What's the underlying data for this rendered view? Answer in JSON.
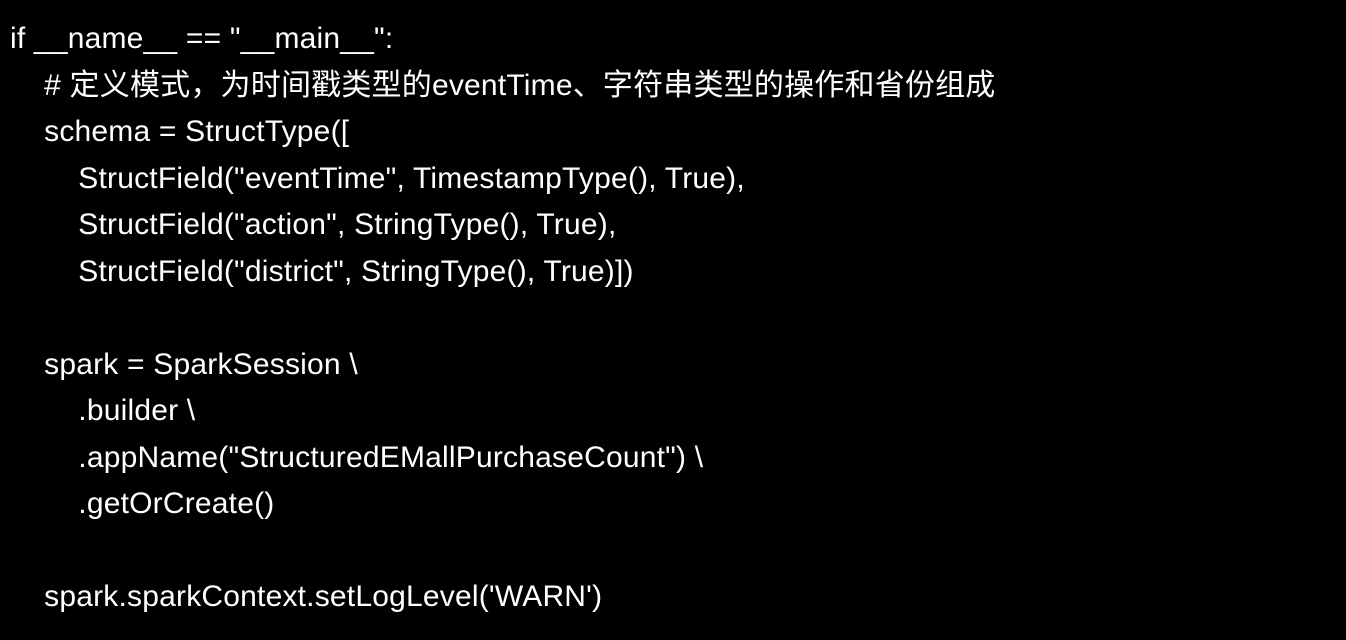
{
  "code": {
    "lines": [
      "if __name__ == \"__main__\":",
      "    # 定义模式，为时间戳类型的eventTime、字符串类型的操作和省份组成",
      "    schema = StructType([",
      "        StructField(\"eventTime\", TimestampType(), True),",
      "        StructField(\"action\", StringType(), True),",
      "        StructField(\"district\", StringType(), True)])",
      "",
      "    spark = SparkSession \\",
      "        .builder \\",
      "        .appName(\"StructuredEMallPurchaseCount\") \\",
      "        .getOrCreate()",
      "",
      "    spark.sparkContext.setLogLevel('WARN')"
    ]
  }
}
